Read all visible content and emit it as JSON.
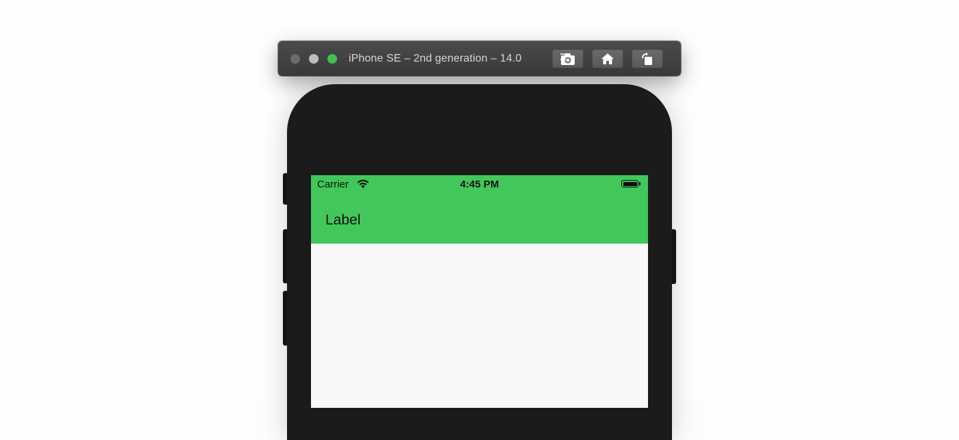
{
  "simulator": {
    "title": "iPhone SE – 2nd generation – 14.0",
    "buttons": {
      "screenshot": "camera-icon",
      "home": "home-icon",
      "rotate": "rotate-icon"
    }
  },
  "status_bar": {
    "carrier": "Carrier",
    "time": "4:45 PM",
    "wifi_icon": "wifi-icon",
    "battery_icon": "battery-icon"
  },
  "header": {
    "label": "Label",
    "background_color": "#42c75a"
  },
  "colors": {
    "device_frame": "#1b1b1b",
    "screen_background": "#f8f8f8",
    "toolbar": "#424242"
  }
}
